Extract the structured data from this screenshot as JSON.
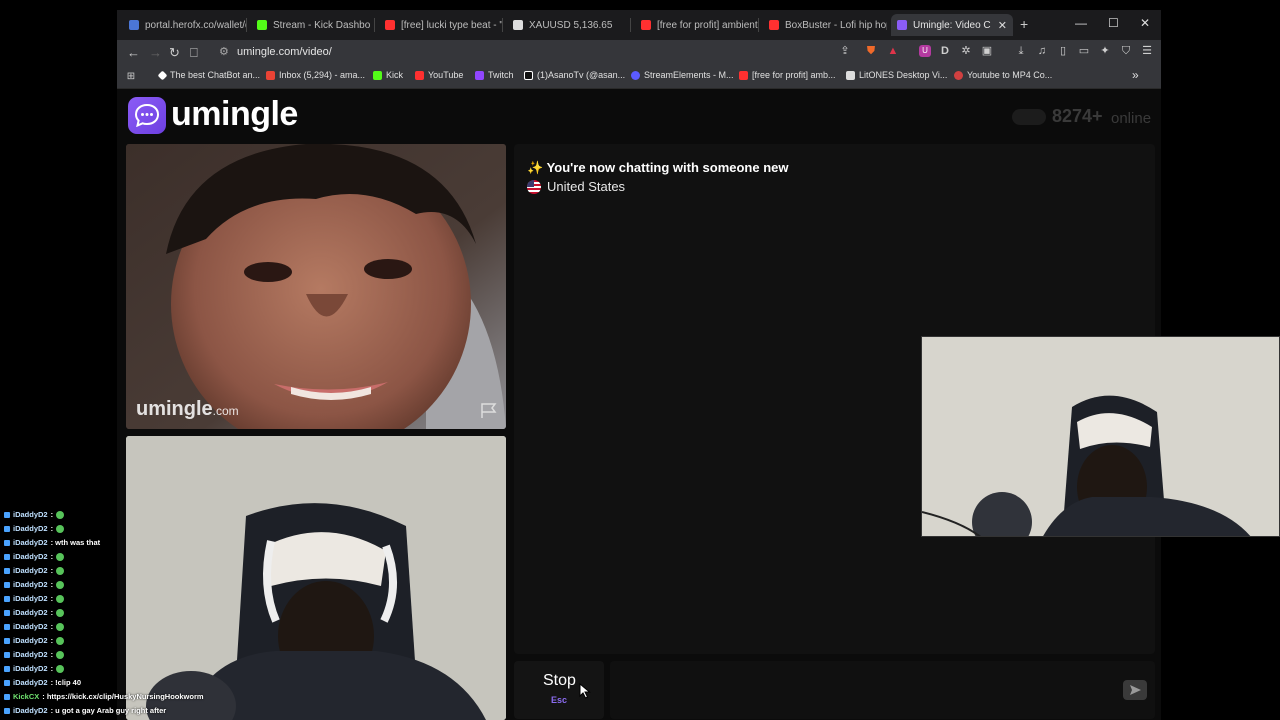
{
  "browser": {
    "tabs": [
      {
        "title": "portal.herofx.co/wallet/d",
        "color": "#4b76d6"
      },
      {
        "title": "Stream - Kick Dashbo",
        "color": "#53fc18"
      },
      {
        "title": "[free] lucki type beat - \"c",
        "color": "#ff3030"
      },
      {
        "title": "XAUUSD 5,136.65",
        "color": "#dddddd"
      },
      {
        "title": "[free for profit] ambient",
        "color": "#ff3030"
      },
      {
        "title": "BoxBuster - Lofi hip hop",
        "color": "#ff3030"
      },
      {
        "title": "Umingle: Video C",
        "color": "#8b5cf6"
      }
    ],
    "new_tab": "+",
    "window_controls": {
      "minimize": "—",
      "maximize": "☐",
      "close": "✕"
    },
    "url": "umingle.com/video/",
    "bookmarks": [
      {
        "label": "The best ChatBot an...",
        "color": "#ffffff"
      },
      {
        "label": "Inbox (5,294) - ama...",
        "color": "#ea4335"
      },
      {
        "label": "Kick",
        "color": "#53fc18"
      },
      {
        "label": "YouTube",
        "color": "#ff3030"
      },
      {
        "label": "Twitch",
        "color": "#9146ff"
      },
      {
        "label": "(1)AsanoTv (@asan...",
        "color": "#ffffff"
      },
      {
        "label": "StreamElements - M...",
        "color": "#5b5bff"
      },
      {
        "label": "[free for profit] amb...",
        "color": "#ff3030"
      },
      {
        "label": "LitONES Desktop Vi...",
        "color": "#dddddd"
      },
      {
        "label": "Youtube to MP4 Co...",
        "color": "#d04040"
      }
    ],
    "more_bookmarks": "»"
  },
  "site": {
    "logo": "umingle",
    "online_count": "8274+",
    "online_label": "online",
    "accent": "#8b5cf6"
  },
  "video": {
    "watermark_main": "umingle",
    "watermark_suffix": ".com"
  },
  "chat": {
    "intro_emoji": "✨",
    "intro": "You're now chatting with someone new",
    "country": "United States"
  },
  "controls": {
    "stop_label": "Stop",
    "stop_key": "Esc",
    "send_icon": "send-arrow"
  },
  "stream_chat": [
    {
      "user": "iDaddyD2",
      "text": ":",
      "emote": true
    },
    {
      "user": "iDaddyD2",
      "text": ":",
      "emote": true
    },
    {
      "user": "iDaddyD2",
      "text": ": wth was that",
      "emote": false
    },
    {
      "user": "iDaddyD2",
      "text": ":",
      "emote": true
    },
    {
      "user": "iDaddyD2",
      "text": ":",
      "emote": true
    },
    {
      "user": "iDaddyD2",
      "text": ":",
      "emote": true
    },
    {
      "user": "iDaddyD2",
      "text": ":",
      "emote": true
    },
    {
      "user": "iDaddyD2",
      "text": ":",
      "emote": true
    },
    {
      "user": "iDaddyD2",
      "text": ":",
      "emote": true
    },
    {
      "user": "iDaddyD2",
      "text": ":",
      "emote": true
    },
    {
      "user": "iDaddyD2",
      "text": ":",
      "emote": true
    },
    {
      "user": "iDaddyD2",
      "text": ":",
      "emote": true
    },
    {
      "user": "iDaddyD2",
      "text": ": !clip 40",
      "emote": false
    },
    {
      "user": "KickCX",
      "text": ": https://kick.cx/clip/HuskyNursingHookworm",
      "emote": false
    },
    {
      "user": "iDaddyD2",
      "text": ": u got a gay Arab guy right after",
      "emote": false
    }
  ]
}
